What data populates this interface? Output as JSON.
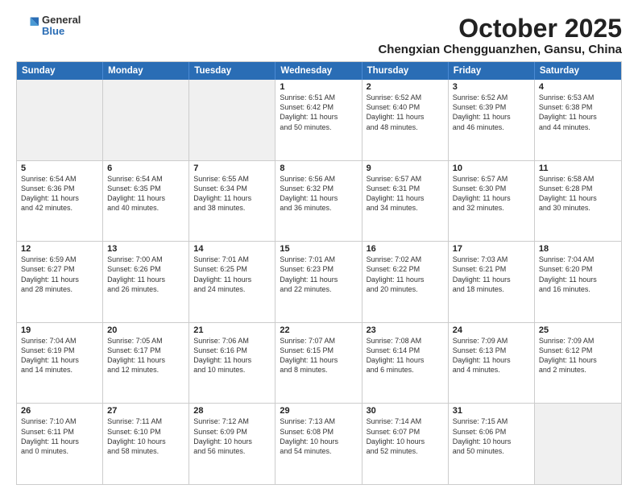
{
  "header": {
    "logo_general": "General",
    "logo_blue": "Blue",
    "month": "October 2025",
    "location": "Chengxian Chengguanzhen, Gansu, China"
  },
  "days_of_week": [
    "Sunday",
    "Monday",
    "Tuesday",
    "Wednesday",
    "Thursday",
    "Friday",
    "Saturday"
  ],
  "weeks": [
    [
      {
        "day": "",
        "content": "",
        "shaded": true
      },
      {
        "day": "",
        "content": "",
        "shaded": true
      },
      {
        "day": "",
        "content": "",
        "shaded": true
      },
      {
        "day": "1",
        "content": "Sunrise: 6:51 AM\nSunset: 6:42 PM\nDaylight: 11 hours\nand 50 minutes."
      },
      {
        "day": "2",
        "content": "Sunrise: 6:52 AM\nSunset: 6:40 PM\nDaylight: 11 hours\nand 48 minutes."
      },
      {
        "day": "3",
        "content": "Sunrise: 6:52 AM\nSunset: 6:39 PM\nDaylight: 11 hours\nand 46 minutes."
      },
      {
        "day": "4",
        "content": "Sunrise: 6:53 AM\nSunset: 6:38 PM\nDaylight: 11 hours\nand 44 minutes."
      }
    ],
    [
      {
        "day": "5",
        "content": "Sunrise: 6:54 AM\nSunset: 6:36 PM\nDaylight: 11 hours\nand 42 minutes."
      },
      {
        "day": "6",
        "content": "Sunrise: 6:54 AM\nSunset: 6:35 PM\nDaylight: 11 hours\nand 40 minutes."
      },
      {
        "day": "7",
        "content": "Sunrise: 6:55 AM\nSunset: 6:34 PM\nDaylight: 11 hours\nand 38 minutes."
      },
      {
        "day": "8",
        "content": "Sunrise: 6:56 AM\nSunset: 6:32 PM\nDaylight: 11 hours\nand 36 minutes."
      },
      {
        "day": "9",
        "content": "Sunrise: 6:57 AM\nSunset: 6:31 PM\nDaylight: 11 hours\nand 34 minutes."
      },
      {
        "day": "10",
        "content": "Sunrise: 6:57 AM\nSunset: 6:30 PM\nDaylight: 11 hours\nand 32 minutes."
      },
      {
        "day": "11",
        "content": "Sunrise: 6:58 AM\nSunset: 6:28 PM\nDaylight: 11 hours\nand 30 minutes."
      }
    ],
    [
      {
        "day": "12",
        "content": "Sunrise: 6:59 AM\nSunset: 6:27 PM\nDaylight: 11 hours\nand 28 minutes."
      },
      {
        "day": "13",
        "content": "Sunrise: 7:00 AM\nSunset: 6:26 PM\nDaylight: 11 hours\nand 26 minutes."
      },
      {
        "day": "14",
        "content": "Sunrise: 7:01 AM\nSunset: 6:25 PM\nDaylight: 11 hours\nand 24 minutes."
      },
      {
        "day": "15",
        "content": "Sunrise: 7:01 AM\nSunset: 6:23 PM\nDaylight: 11 hours\nand 22 minutes."
      },
      {
        "day": "16",
        "content": "Sunrise: 7:02 AM\nSunset: 6:22 PM\nDaylight: 11 hours\nand 20 minutes."
      },
      {
        "day": "17",
        "content": "Sunrise: 7:03 AM\nSunset: 6:21 PM\nDaylight: 11 hours\nand 18 minutes."
      },
      {
        "day": "18",
        "content": "Sunrise: 7:04 AM\nSunset: 6:20 PM\nDaylight: 11 hours\nand 16 minutes."
      }
    ],
    [
      {
        "day": "19",
        "content": "Sunrise: 7:04 AM\nSunset: 6:19 PM\nDaylight: 11 hours\nand 14 minutes."
      },
      {
        "day": "20",
        "content": "Sunrise: 7:05 AM\nSunset: 6:17 PM\nDaylight: 11 hours\nand 12 minutes."
      },
      {
        "day": "21",
        "content": "Sunrise: 7:06 AM\nSunset: 6:16 PM\nDaylight: 11 hours\nand 10 minutes."
      },
      {
        "day": "22",
        "content": "Sunrise: 7:07 AM\nSunset: 6:15 PM\nDaylight: 11 hours\nand 8 minutes."
      },
      {
        "day": "23",
        "content": "Sunrise: 7:08 AM\nSunset: 6:14 PM\nDaylight: 11 hours\nand 6 minutes."
      },
      {
        "day": "24",
        "content": "Sunrise: 7:09 AM\nSunset: 6:13 PM\nDaylight: 11 hours\nand 4 minutes."
      },
      {
        "day": "25",
        "content": "Sunrise: 7:09 AM\nSunset: 6:12 PM\nDaylight: 11 hours\nand 2 minutes."
      }
    ],
    [
      {
        "day": "26",
        "content": "Sunrise: 7:10 AM\nSunset: 6:11 PM\nDaylight: 11 hours\nand 0 minutes."
      },
      {
        "day": "27",
        "content": "Sunrise: 7:11 AM\nSunset: 6:10 PM\nDaylight: 10 hours\nand 58 minutes."
      },
      {
        "day": "28",
        "content": "Sunrise: 7:12 AM\nSunset: 6:09 PM\nDaylight: 10 hours\nand 56 minutes."
      },
      {
        "day": "29",
        "content": "Sunrise: 7:13 AM\nSunset: 6:08 PM\nDaylight: 10 hours\nand 54 minutes."
      },
      {
        "day": "30",
        "content": "Sunrise: 7:14 AM\nSunset: 6:07 PM\nDaylight: 10 hours\nand 52 minutes."
      },
      {
        "day": "31",
        "content": "Sunrise: 7:15 AM\nSunset: 6:06 PM\nDaylight: 10 hours\nand 50 minutes."
      },
      {
        "day": "",
        "content": "",
        "shaded": true
      }
    ]
  ]
}
